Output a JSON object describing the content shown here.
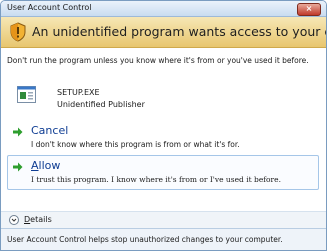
{
  "window": {
    "title": "User Account Control",
    "close_label": "×"
  },
  "banner": {
    "text": "An unidentified program wants access to your computer",
    "icon": "shield-icon"
  },
  "warning_text": "Don't run the program unless you know where it's from or you've used it before.",
  "program": {
    "file_name": "SETUP.EXE",
    "publisher": "Unidentified Publisher",
    "icon": "program-icon"
  },
  "options": {
    "cancel": {
      "title": "Cancel",
      "description": "I don't know where this program is from or what it's for.",
      "icon": "green-arrow-icon"
    },
    "allow": {
      "title_mnemonic": "A",
      "title_rest": "llow",
      "description": "I trust this program. I know where it's from or I've used it before.",
      "icon": "green-arrow-icon"
    }
  },
  "details": {
    "mnemonic": "D",
    "label_rest": "etails",
    "icon": "chevron-down-icon"
  },
  "footer": {
    "text": "User Account Control helps stop unauthorized changes to your computer."
  },
  "colors": {
    "banner": "#e8c66f",
    "link": "#0f3d93",
    "arrow": "#2e9e2e"
  }
}
